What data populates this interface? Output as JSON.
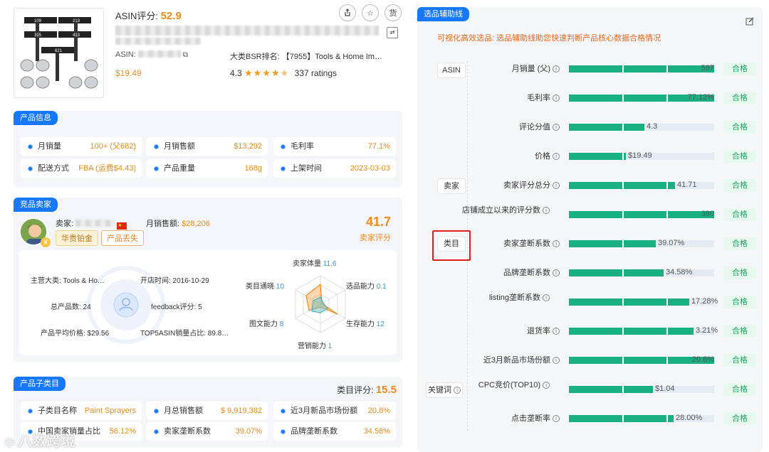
{
  "product": {
    "asin_score_label": "ASIN评分:",
    "asin_score": "52.9",
    "asin_label": "ASIN:",
    "bsr_label": "大类BSR排名:",
    "bsr_value": "【7955】Tools & Home Im…",
    "price": "$19.49",
    "rating": "4.3",
    "stars": 4.3,
    "ratings_count": "337 ratings",
    "icon_share": "share-icon",
    "icon_star": "star-icon",
    "icon_cargo_label": "货",
    "image_labels": [
      "109",
      "213",
      "315",
      "413",
      "621"
    ]
  },
  "product_info": {
    "title": "产品信息",
    "cells": [
      {
        "k": "月销量",
        "v": "100+ (父682)"
      },
      {
        "k": "月销售额",
        "v": "$13,292"
      },
      {
        "k": "毛利率",
        "v": "77.1%"
      },
      {
        "k": "配送方式",
        "v": "FBA (运费$4.43)"
      },
      {
        "k": "产品重量",
        "v": "168g"
      },
      {
        "k": "上架时间",
        "v": "2023-03-03"
      }
    ]
  },
  "seller": {
    "title": "竞品卖家",
    "seller_label": "卖家:",
    "monthly_sales_label": "月销售额:",
    "monthly_sales": "$28,206",
    "badge1": "华贵铂金",
    "badge2": "产品丢失",
    "score": "41.7",
    "score_label": "卖家评分",
    "info": [
      "主营大类: Tools & Ho…",
      "开店时间: 2016-10-29",
      "总产品数: 24",
      "feedback评分: 5",
      "产品平均价格: $29.56",
      "TOP5ASIN销量占比: 89.8…"
    ],
    "radar": [
      {
        "name": "卖家体量",
        "value": "11.6"
      },
      {
        "name": "选品能力",
        "value": "0.1"
      },
      {
        "name": "生存能力",
        "value": "12"
      },
      {
        "name": "营销能力",
        "value": "1"
      },
      {
        "name": "图文能力",
        "value": "8"
      },
      {
        "name": "类目通晓",
        "value": "10"
      }
    ]
  },
  "subcat": {
    "title": "产品子类目",
    "score_label": "类目评分:",
    "score": "15.5",
    "cells": [
      {
        "k": "子类目名称",
        "v": "Paint Sprayers"
      },
      {
        "k": "月总销售额",
        "v": "$ 9,919,382"
      },
      {
        "k": "近3月新品市场份额",
        "v": "20.8%"
      },
      {
        "k": "中国卖家销量占比",
        "v": "56.12%"
      },
      {
        "k": "卖家垄断系数",
        "v": "39.07%"
      },
      {
        "k": "品牌垄断系数",
        "v": "34.58%"
      }
    ]
  },
  "watermark": "八数跨境",
  "aux": {
    "title": "选品辅助线",
    "subtitle": "可视化高效选品: 选品辅助线助您快速判断产品核心数据合格情况",
    "edit_icon": "edit-icon",
    "groups": [
      "ASIN",
      "卖家",
      "类目",
      "关键词"
    ],
    "metrics": [
      {
        "name": "月销量 (父)",
        "value": "597",
        "fill": 1.0,
        "status": "合格"
      },
      {
        "name": "毛利率",
        "value": "77.12%",
        "fill": 1.0,
        "status": "合格"
      },
      {
        "name": "评论分值",
        "value": "4.3",
        "fill": 0.52,
        "status": "合格"
      },
      {
        "name": "价格",
        "value": "$19.49",
        "fill": 0.39,
        "status": "合格"
      },
      {
        "name": "卖家评分总分",
        "value": "41.71",
        "fill": 0.73,
        "status": "合格"
      },
      {
        "name": "店铺成立以来的评分数",
        "value": "380",
        "fill": 1.0,
        "status": "合格"
      },
      {
        "name": "卖家垄断系数",
        "value": "39.07%",
        "fill": 0.6,
        "status": "合格"
      },
      {
        "name": "品牌垄断系数",
        "value": "34.58%",
        "fill": 0.65,
        "status": "合格"
      },
      {
        "name": "listing垄断系数",
        "value": "17.28%",
        "fill": 0.83,
        "status": "合格"
      },
      {
        "name": "退货率",
        "value": "3.21%",
        "fill": 0.86,
        "status": "合格"
      },
      {
        "name": "近3月新品市场份额",
        "value": "20.8%",
        "fill": 1.0,
        "status": "合格"
      },
      {
        "name": "CPC竞价(TOP10)",
        "value": "$1.04",
        "fill": 0.58,
        "status": "合格"
      },
      {
        "name": "点击垄断率",
        "value": "28.00%",
        "fill": 0.72,
        "status": "合格"
      }
    ]
  }
}
